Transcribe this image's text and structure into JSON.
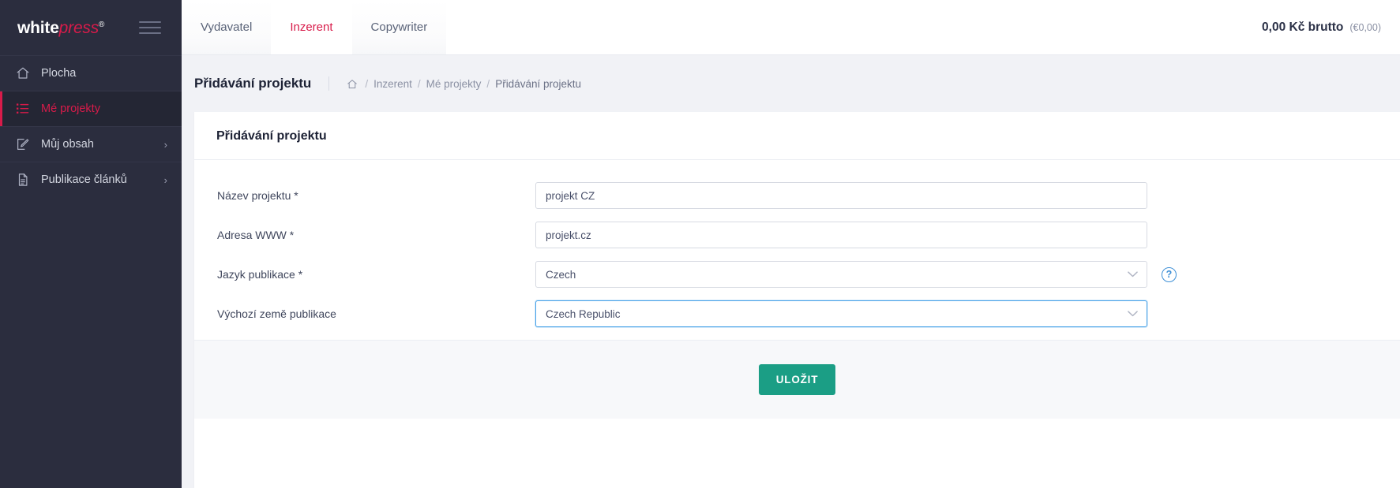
{
  "sidebar": {
    "logo": {
      "part1": "white",
      "part2": "press",
      "registered": "®"
    },
    "items": [
      {
        "label": "Plocha",
        "icon": "home-icon",
        "active": false,
        "chevron": ""
      },
      {
        "label": "Mé projekty",
        "icon": "list-icon",
        "active": true,
        "chevron": ""
      },
      {
        "label": "Můj obsah",
        "icon": "edit-square-icon",
        "active": false,
        "chevron": "›"
      },
      {
        "label": "Publikace článků",
        "icon": "document-icon",
        "active": false,
        "chevron": "›"
      }
    ]
  },
  "topbar": {
    "tabs": [
      {
        "label": "Vydavatel",
        "active": false
      },
      {
        "label": "Inzerent",
        "active": true
      },
      {
        "label": "Copywriter",
        "active": false
      }
    ],
    "balance": {
      "amount": "0,00 Kč brutto",
      "secondary": "(€0,00)"
    }
  },
  "page": {
    "title": "Přidávání projektu",
    "breadcrumb": {
      "home_icon": "home-icon",
      "items": [
        "Inzerent",
        "Mé projekty",
        "Přidávání projektu"
      ],
      "separator": "/"
    }
  },
  "card": {
    "header": "Přidávání projektu",
    "fields": [
      {
        "label": "Název projektu *",
        "type": "text",
        "value": "projekt CZ",
        "placeholder": ""
      },
      {
        "label": "Adresa WWW *",
        "type": "text",
        "value": "projekt.cz",
        "placeholder": ""
      },
      {
        "label": "Jazyk publikace *",
        "type": "select",
        "value": "Czech",
        "focused": false,
        "help": "?"
      },
      {
        "label": "Výchozí země publikace",
        "type": "select",
        "value": "Czech Republic",
        "focused": true,
        "help": ""
      }
    ],
    "save_label": "ULOŽIT"
  },
  "colors": {
    "sidebar_bg": "#2b2d3e",
    "accent_red": "#d81b4a",
    "save_green": "#1b9e85",
    "focus_blue": "#4aa3e8",
    "page_bg": "#f1f2f6"
  }
}
